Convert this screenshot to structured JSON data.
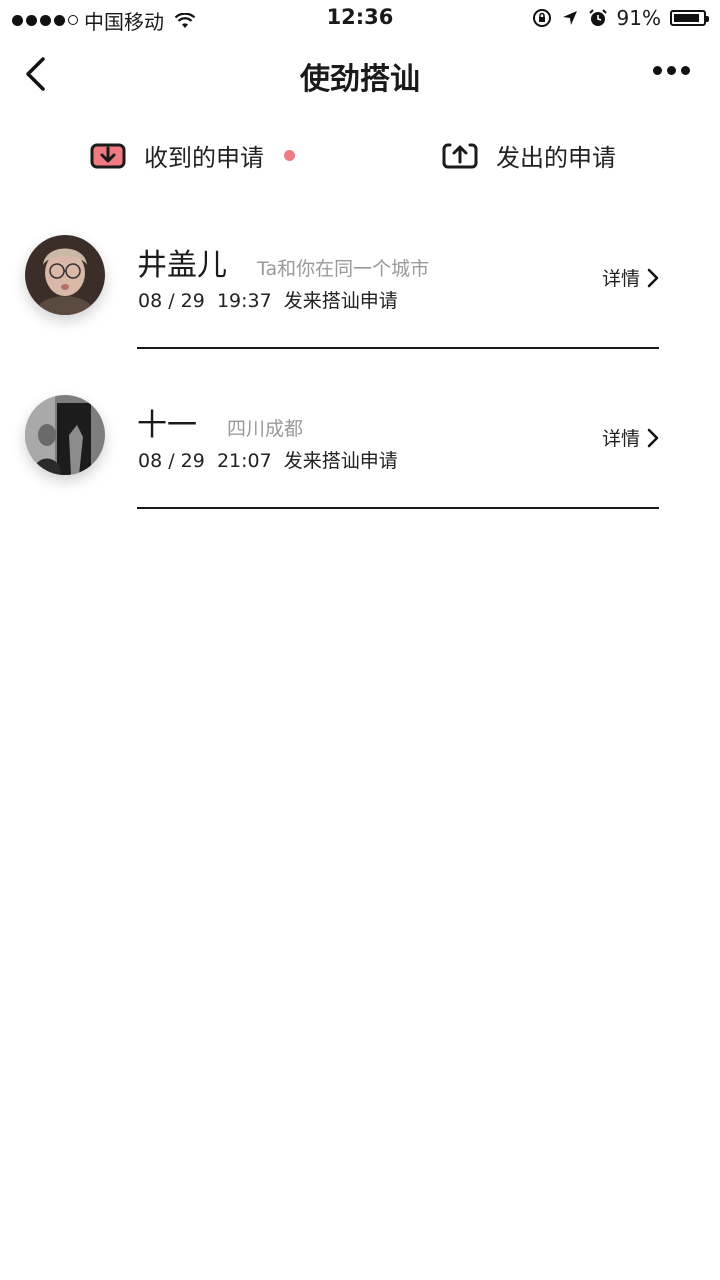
{
  "status_bar": {
    "carrier": "中国移动",
    "time": "12:36",
    "battery": "91%",
    "battery_level": 0.91,
    "icons": [
      "signal-dots-icon",
      "wifi-icon",
      "orientation-lock-icon",
      "location-arrow-icon",
      "alarm-icon",
      "battery-icon"
    ]
  },
  "navbar": {
    "title": "使劲搭讪",
    "icons": [
      "back-arrow-icon",
      "more-dots-icon"
    ]
  },
  "tabs": {
    "received": {
      "label": "收到的申请",
      "icon": "inbox-download-icon",
      "has_unread": true,
      "accent": "#ef7b82"
    },
    "sent": {
      "label": "发出的申请",
      "icon": "outbox-upload-icon"
    }
  },
  "requests": [
    {
      "name": "井盖儿",
      "subtitle": "Ta和你在同一个城市",
      "date": "08 / 29",
      "time": "19:37",
      "action": "发来搭讪申请",
      "detail": "详情"
    },
    {
      "name": "十一",
      "subtitle": "四川成都",
      "date": "08 / 29",
      "time": "21:07",
      "action": "发来搭讪申请",
      "detail": "详情"
    }
  ]
}
